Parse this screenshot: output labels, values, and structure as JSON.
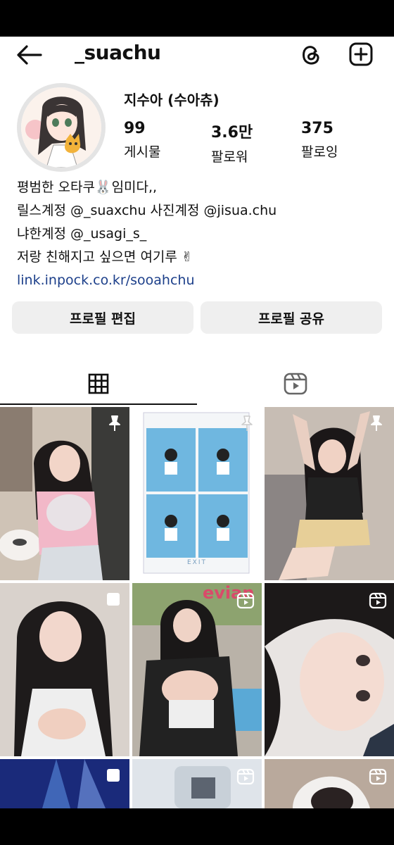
{
  "header": {
    "username": "_suachu",
    "back_icon": "arrow-left-icon",
    "threads_icon": "threads-icon",
    "create_icon": "plus-square-icon"
  },
  "profile": {
    "display_name": "지수아 (수아츄)",
    "stats": [
      {
        "value": "99",
        "label": "게시물"
      },
      {
        "value": "3.6만",
        "label": "팔로워"
      },
      {
        "value": "375",
        "label": "팔로잉"
      }
    ],
    "bio": [
      "평범한 오타쿠🐰임미다,,",
      "릴스계정 @_suaxchu 사진계정 @jisua.chu",
      "냐한계정 @_usagi_s_",
      "저랑 친해지고 싶으면 여기루 ✌︎"
    ],
    "link": "link.inpock.co.kr/sooahchu"
  },
  "buttons": {
    "edit_profile": "프로필 편집",
    "share_profile": "프로필 공유"
  },
  "tabs": [
    {
      "icon": "grid-icon",
      "active": true
    },
    {
      "icon": "reels-icon",
      "active": false
    }
  ],
  "grid_overlays": {
    "poster_text": "EXIT",
    "brand_text": "evian"
  }
}
